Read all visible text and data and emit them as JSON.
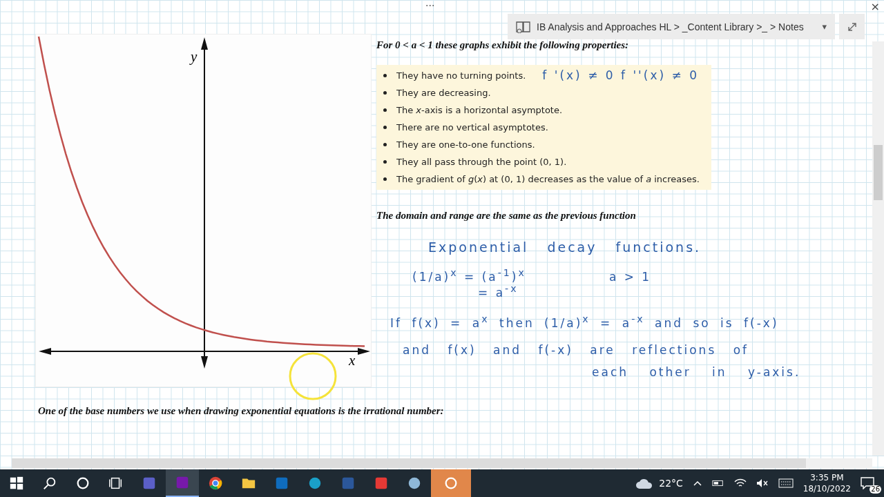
{
  "window": {
    "menu_dots": "···",
    "close": "×"
  },
  "breadcrumb": {
    "text": "IB Analysis and Approaches HL > _Content Library >_ > Notes",
    "caret": "▾"
  },
  "graph": {
    "y_label": "y",
    "x_label": "x"
  },
  "heading": "For 0 < a < 1 these graphs exhibit the following properties:",
  "properties": [
    {
      "text": "They have no turning points.",
      "note": "f '(x) ≠ 0   f ''(x) ≠ 0"
    },
    {
      "text": "They are decreasing."
    },
    {
      "text": "The *x*-axis is a horizontal asymptote."
    },
    {
      "text": "There are no vertical asymptotes."
    },
    {
      "text": "They are one-to-one functions."
    },
    {
      "text": "They all pass through the point (0, 1)."
    },
    {
      "text": "The gradient of *g*(*x*) at (0, 1) decreases as the value of *a* increases."
    }
  ],
  "domain_note": "The domain and range are the same as the previous function",
  "handwriting": {
    "title": "Exponential  decay  functions.",
    "eq1": "(1/a)$^{x}$ = (a$^{-1}$)$^{x}$",
    "eq2": "= a$^{-x}$",
    "condition": "a > 1",
    "line1": "If  f(x) = a$^{x}$  then  (1/a)$^{x}$ = a$^{-x}$  and so  is f(-x)",
    "line2": "and  f(x)  and  f(-x)  are  reflections  of",
    "line3": "each  other  in  y-axis."
  },
  "footer_note": "One of the base numbers we use when drawing exponential equations is the irrational number:",
  "taskbar": {
    "apps": [
      {
        "kind": "start",
        "selected": false
      },
      {
        "kind": "search",
        "selected": false
      },
      {
        "kind": "cortana",
        "selected": false
      },
      {
        "kind": "taskview",
        "selected": false
      },
      {
        "kind": "teams",
        "selected": false
      },
      {
        "kind": "onenote",
        "selected": true
      },
      {
        "kind": "chrome",
        "selected": false
      },
      {
        "kind": "folder",
        "selected": false
      },
      {
        "kind": "outlook",
        "selected": false
      },
      {
        "kind": "webex",
        "selected": false
      },
      {
        "kind": "word",
        "selected": false
      },
      {
        "kind": "reader",
        "selected": false
      },
      {
        "kind": "snip",
        "selected": false
      },
      {
        "kind": "record",
        "selected": true
      }
    ],
    "weather": "22°C",
    "time": "3:35 PM",
    "date": "18/10/2022",
    "notifications": "26"
  }
}
